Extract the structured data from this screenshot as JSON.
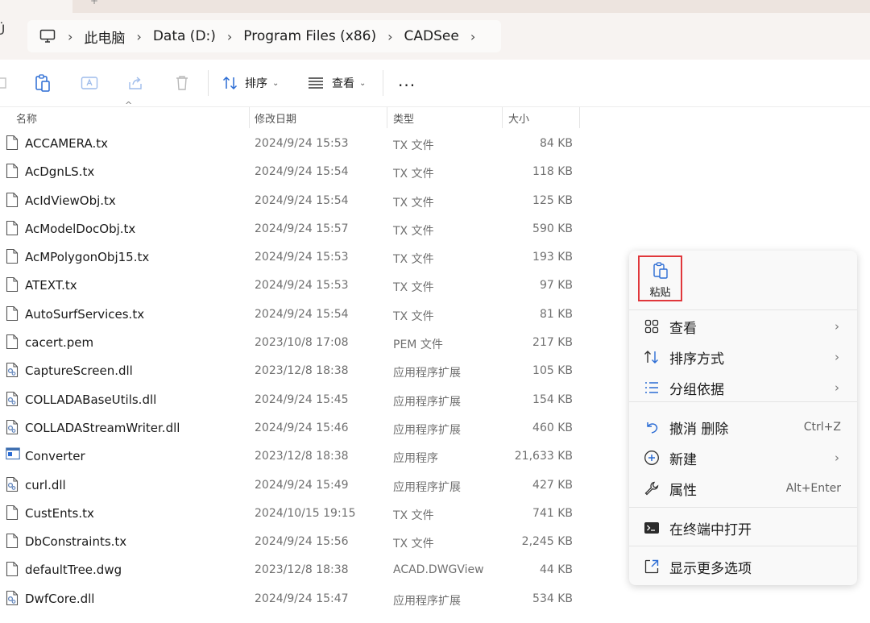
{
  "tabstrip": {
    "partial_char": "+"
  },
  "address": {
    "left_glyph": "Ü",
    "crumbs": [
      "此电脑",
      "Data (D:)",
      "Program Files (x86)",
      "CADSee"
    ],
    "separator": "›"
  },
  "toolbar": {
    "sort_label": "排序",
    "view_label": "查看",
    "more_label": "···",
    "chevron": "⌄"
  },
  "columns": {
    "name": "名称",
    "date": "修改日期",
    "type": "类型",
    "size": "大小",
    "sort_caret": "^"
  },
  "files": [
    {
      "name": "ACCAMERA.tx",
      "date": "2024/9/24 15:53",
      "type": "TX 文件",
      "size": "84 KB",
      "icon": "file-icon"
    },
    {
      "name": "AcDgnLS.tx",
      "date": "2024/9/24 15:54",
      "type": "TX 文件",
      "size": "118 KB",
      "icon": "file-icon"
    },
    {
      "name": "AcIdViewObj.tx",
      "date": "2024/9/24 15:54",
      "type": "TX 文件",
      "size": "125 KB",
      "icon": "file-icon"
    },
    {
      "name": "AcModelDocObj.tx",
      "date": "2024/9/24 15:57",
      "type": "TX 文件",
      "size": "590 KB",
      "icon": "file-icon"
    },
    {
      "name": "AcMPolygonObj15.tx",
      "date": "2024/9/24 15:53",
      "type": "TX 文件",
      "size": "193 KB",
      "icon": "file-icon"
    },
    {
      "name": "ATEXT.tx",
      "date": "2024/9/24 15:53",
      "type": "TX 文件",
      "size": "97 KB",
      "icon": "file-icon"
    },
    {
      "name": "AutoSurfServices.tx",
      "date": "2024/9/24 15:54",
      "type": "TX 文件",
      "size": "81 KB",
      "icon": "file-icon"
    },
    {
      "name": "cacert.pem",
      "date": "2023/10/8 17:08",
      "type": "PEM 文件",
      "size": "217 KB",
      "icon": "file-icon"
    },
    {
      "name": "CaptureScreen.dll",
      "date": "2023/12/8 18:38",
      "type": "应用程序扩展",
      "size": "105 KB",
      "icon": "dll-icon"
    },
    {
      "name": "COLLADABaseUtils.dll",
      "date": "2024/9/24 15:45",
      "type": "应用程序扩展",
      "size": "154 KB",
      "icon": "dll-icon"
    },
    {
      "name": "COLLADAStreamWriter.dll",
      "date": "2024/9/24 15:46",
      "type": "应用程序扩展",
      "size": "460 KB",
      "icon": "dll-icon"
    },
    {
      "name": "Converter",
      "date": "2023/12/8 18:38",
      "type": "应用程序",
      "size": "21,633 KB",
      "icon": "app-icon"
    },
    {
      "name": "curl.dll",
      "date": "2024/9/24 15:49",
      "type": "应用程序扩展",
      "size": "427 KB",
      "icon": "dll-icon"
    },
    {
      "name": "CustEnts.tx",
      "date": "2024/10/15 19:15",
      "type": "TX 文件",
      "size": "741 KB",
      "icon": "file-icon"
    },
    {
      "name": "DbConstraints.tx",
      "date": "2024/9/24 15:56",
      "type": "TX 文件",
      "size": "2,245 KB",
      "icon": "file-icon"
    },
    {
      "name": "defaultTree.dwg",
      "date": "2023/12/8 18:38",
      "type": "ACAD.DWGView",
      "size": "44 KB",
      "icon": "file-icon"
    },
    {
      "name": "DwfCore.dll",
      "date": "2024/9/24 15:47",
      "type": "应用程序扩展",
      "size": "534 KB",
      "icon": "dll-icon"
    }
  ],
  "context_menu": {
    "paste_label": "粘贴",
    "arrow": "›",
    "items": [
      {
        "label": "查看",
        "shortcut": "",
        "submenu": true,
        "icon": "grid-view-icon"
      },
      {
        "label": "排序方式",
        "shortcut": "",
        "submenu": true,
        "icon": "sort-icon"
      },
      {
        "label": "分组依据",
        "shortcut": "",
        "submenu": true,
        "icon": "group-by-icon"
      },
      {
        "label": "撤消 删除",
        "shortcut": "Ctrl+Z",
        "submenu": false,
        "icon": "undo-icon"
      },
      {
        "label": "新建",
        "shortcut": "",
        "submenu": true,
        "icon": "new-plus-icon"
      },
      {
        "label": "属性",
        "shortcut": "Alt+Enter",
        "submenu": false,
        "icon": "wrench-icon"
      },
      {
        "label": "在终端中打开",
        "shortcut": "",
        "submenu": false,
        "icon": "terminal-icon"
      },
      {
        "label": "显示更多选项",
        "shortcut": "",
        "submenu": false,
        "icon": "more-options-icon"
      }
    ]
  },
  "colors": {
    "highlight_border": "#e0373b",
    "accent_blue": "#2b6cd4"
  }
}
